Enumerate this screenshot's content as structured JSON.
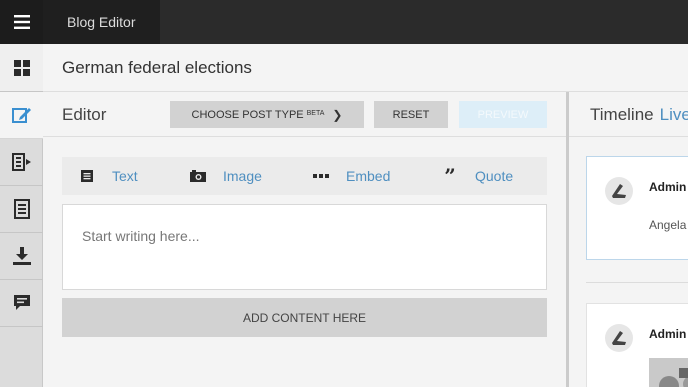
{
  "topbar": {
    "menu_icon": "hamburger-icon",
    "app_tab": "Blog Editor"
  },
  "sidebar": {
    "items": [
      {
        "icon": "dashboard-icon"
      },
      {
        "icon": "edit-icon",
        "active": true
      },
      {
        "icon": "output-icon"
      },
      {
        "icon": "document-icon"
      },
      {
        "icon": "download-icon"
      },
      {
        "icon": "comment-icon"
      }
    ]
  },
  "page": {
    "title": "German federal elections"
  },
  "editor": {
    "label": "Editor",
    "choose_type": "CHOOSE POST TYPE",
    "choose_type_badge": "BETA",
    "reset": "RESET",
    "preview": "PREVIEW",
    "tools": [
      {
        "icon": "text-icon",
        "label": "Text"
      },
      {
        "icon": "camera-icon",
        "label": "Image"
      },
      {
        "icon": "embed-icon",
        "label": "Embed"
      },
      {
        "icon": "quote-icon",
        "label": "Quote"
      }
    ],
    "placeholder": "Start writing here...",
    "add_content": "ADD CONTENT HERE"
  },
  "timeline": {
    "label": "Timeline",
    "live": "Live",
    "posts": [
      {
        "author": "Admin",
        "text": "Angela"
      },
      {
        "author": "Admin",
        "text": ""
      }
    ]
  },
  "colors": {
    "accent": "#4f8fc0",
    "topbar": "#2b2b2b",
    "sidebar_active_icon": "#3a8fd0"
  }
}
